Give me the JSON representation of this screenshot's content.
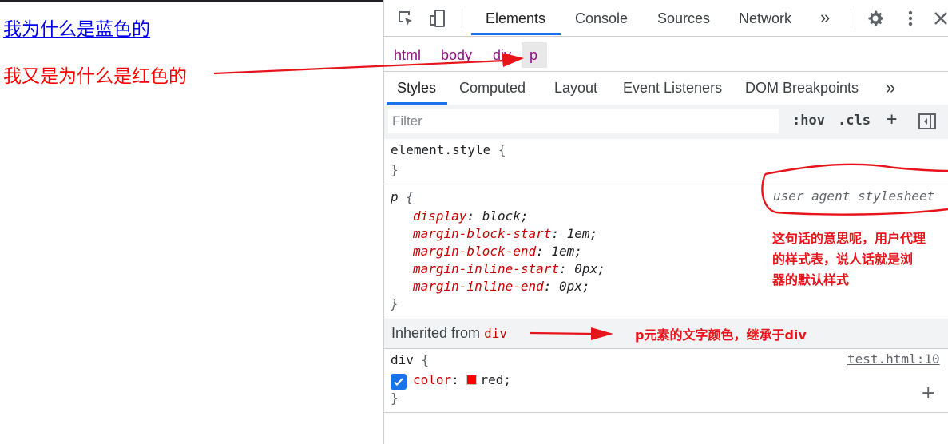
{
  "page": {
    "link_text": "我为什么是蓝色的",
    "red_text": "我又是为什么是红色的"
  },
  "devtools": {
    "main_tabs": [
      "Elements",
      "Console",
      "Sources",
      "Network"
    ],
    "active_tab": "Elements",
    "more_tabs_glyph": "»",
    "breadcrumbs": [
      "html",
      "body",
      "div",
      "p"
    ],
    "selected_breadcrumb": "p",
    "sub_tabs": [
      "Styles",
      "Computed",
      "Layout",
      "Event Listeners",
      "DOM Breakpoints"
    ],
    "active_sub_tab": "Styles",
    "filter": {
      "placeholder": "Filter",
      "value": ""
    },
    "filter_buttons": {
      "hov": ":hov",
      "cls": ".cls",
      "add": "+"
    },
    "element_style": {
      "selector": "element.style",
      "open": "{",
      "close": "}"
    },
    "ua_rule": {
      "selector": "p",
      "source": "user agent stylesheet",
      "declarations": [
        {
          "prop": "display",
          "value": "block"
        },
        {
          "prop": "margin-block-start",
          "value": "1em"
        },
        {
          "prop": "margin-block-end",
          "value": "1em"
        },
        {
          "prop": "margin-inline-start",
          "value": "0px"
        },
        {
          "prop": "margin-inline-end",
          "value": "0px"
        }
      ]
    },
    "inherited": {
      "label": "Inherited from",
      "tag": "div"
    },
    "div_rule": {
      "selector": "div",
      "source": "test.html:10",
      "declaration": {
        "prop": "color",
        "value": "red",
        "checked": true,
        "swatch_color": "#ff0000"
      },
      "add_glyph": "+"
    }
  },
  "annotations": {
    "ua_note": [
      "这句话的意思呢，用户代理",
      "的样式表，说人话就是浏",
      "器的默认样式"
    ],
    "inherit_note": "p元素的文字颜色，继承于div",
    "color": "#e8141c"
  },
  "colors": {
    "link_blue": "#0000ee",
    "red": "#ff0000",
    "accent_blue": "#1a73e8",
    "tag_purple": "#881280",
    "prop_red": "#c80000"
  }
}
